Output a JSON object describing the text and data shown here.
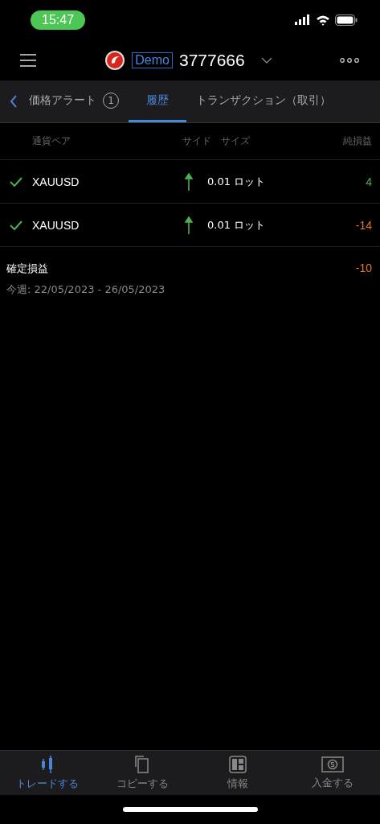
{
  "status_bar": {
    "time": "15:47"
  },
  "header": {
    "account_type": "Demo",
    "account_number": "3777666"
  },
  "tabs": [
    {
      "label": "価格アラート",
      "badge": "1",
      "selected": false
    },
    {
      "label": "履歴",
      "selected": true
    },
    {
      "label": "トランザクション（取引）",
      "selected": false
    }
  ],
  "table": {
    "columns": [
      "通貨ペア",
      "サイド",
      "サイズ",
      "純損益"
    ],
    "rows": [
      {
        "done": true,
        "symbol": "XAUUSD",
        "kind": "up",
        "size": "0.01 ロット",
        "pnl": "4",
        "color": "#4caf50"
      },
      {
        "done": true,
        "symbol": "XAUUSD",
        "kind": "up",
        "size": "0.01 ロット",
        "pnl": "-14",
        "color": "#e8761e"
      }
    ]
  },
  "summary": {
    "label": "確定損益",
    "value": "-10",
    "color": "#e8761e",
    "period": "今週: 22/05/2023 - 26/05/2023"
  },
  "bottom_nav": [
    {
      "label": "トレードする",
      "kind": "trade",
      "selected": true
    },
    {
      "label": "コピーする",
      "kind": "copy",
      "selected": false
    },
    {
      "label": "情報",
      "kind": "info",
      "selected": false
    },
    {
      "label": "入金する",
      "kind": "deposit",
      "selected": false
    }
  ]
}
